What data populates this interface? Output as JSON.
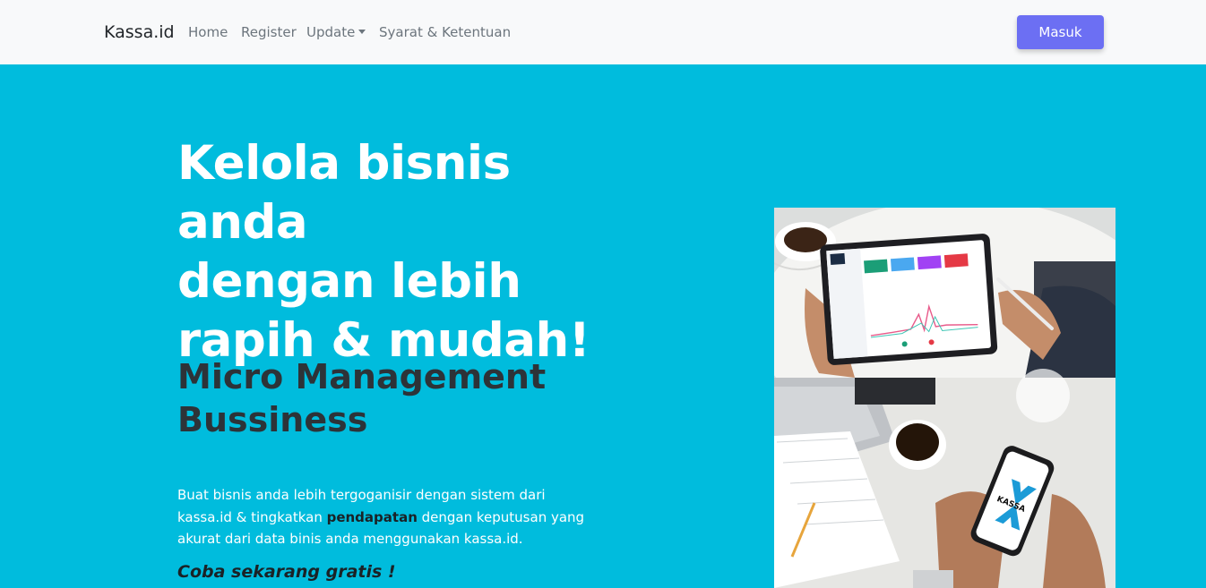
{
  "navbar": {
    "brand": "Kassa.id",
    "links": [
      {
        "label": "Home"
      },
      {
        "label": "Register"
      },
      {
        "label": "Update"
      },
      {
        "label": "Syarat & Ketentuan"
      }
    ],
    "login_label": "Masuk",
    "login_color": "#6c6ff3"
  },
  "hero": {
    "title_line1": "Kelola bisnis anda",
    "title_line2": "dengan lebih",
    "title_line3": "rapih & mudah!",
    "subtitle_line1": "Micro Management",
    "subtitle_line2": "Bussiness",
    "description_part1": "Buat bisnis anda lebih tergoganisir dengan sistem dari kassa.id & tingkatkan ",
    "description_bold": "pendapatan",
    "description_part2": " dengan keputusan yang akurat dari data binis anda menggunakan kassa.id.",
    "cta": "Coba sekarang gratis !",
    "background_color": "#00bcdd"
  },
  "image": {
    "phone_logo_text": "KASSA"
  }
}
